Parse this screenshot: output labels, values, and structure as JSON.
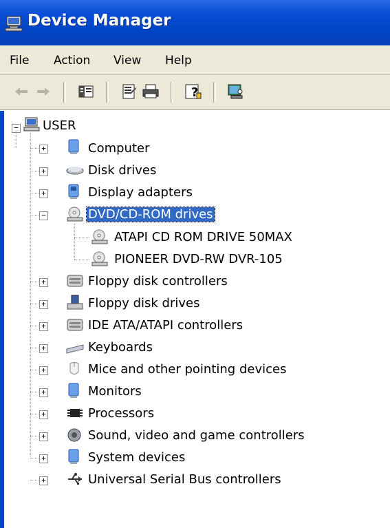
{
  "window": {
    "title": "Device Manager"
  },
  "menu": [
    "File",
    "Action",
    "View",
    "Help"
  ],
  "toolbar": {
    "buttons": [
      {
        "name": "back-arrow-icon",
        "enabled": false
      },
      {
        "name": "forward-arrow-icon",
        "enabled": false
      },
      {
        "name": "show-hide-console-tree-icon",
        "enabled": true
      },
      {
        "name": "properties-icon",
        "enabled": true
      },
      {
        "name": "print-icon",
        "enabled": true
      },
      {
        "name": "help-icon",
        "enabled": true
      },
      {
        "name": "scan-hardware-icon",
        "enabled": true
      }
    ]
  },
  "tree": {
    "root": "USER",
    "items": [
      {
        "label": "Computer",
        "icon": "computer-icon",
        "expanded": false
      },
      {
        "label": "Disk drives",
        "icon": "disk-drive-icon",
        "expanded": false
      },
      {
        "label": "Display adapters",
        "icon": "display-adapter-icon",
        "expanded": false
      },
      {
        "label": "DVD/CD-ROM drives",
        "icon": "cdrom-icon",
        "expanded": true,
        "selected": true,
        "children": [
          "ATAPI CD ROM DRIVE  50MAX",
          "PIONEER DVD-RW  DVR-105"
        ]
      },
      {
        "label": "Floppy disk controllers",
        "icon": "controller-icon",
        "expanded": false
      },
      {
        "label": "Floppy disk drives",
        "icon": "floppy-drive-icon",
        "expanded": false
      },
      {
        "label": "IDE ATA/ATAPI controllers",
        "icon": "controller-icon",
        "expanded": false
      },
      {
        "label": "Keyboards",
        "icon": "keyboard-icon",
        "expanded": false
      },
      {
        "label": "Mice and other pointing devices",
        "icon": "mouse-icon",
        "expanded": false
      },
      {
        "label": "Monitors",
        "icon": "monitor-icon",
        "expanded": false
      },
      {
        "label": "Processors",
        "icon": "processor-icon",
        "expanded": false
      },
      {
        "label": "Sound, video and game controllers",
        "icon": "sound-icon",
        "expanded": false
      },
      {
        "label": "System devices",
        "icon": "system-devices-icon",
        "expanded": false
      },
      {
        "label": "Universal Serial Bus controllers",
        "icon": "usb-icon",
        "expanded": false
      }
    ]
  },
  "colors": {
    "title_bar": "#0046c8",
    "selection": "#316ac5",
    "chrome": "#ece9d8"
  }
}
